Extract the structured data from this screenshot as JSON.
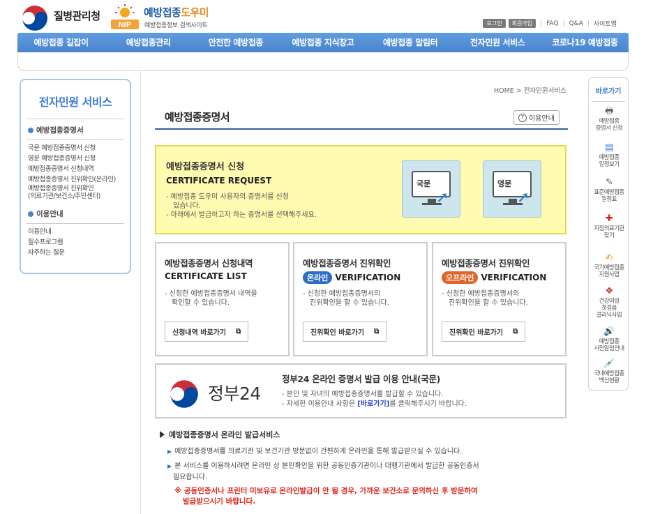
{
  "header": {
    "gov_name": "질병관리청",
    "nip_badge": "NIP",
    "brand_main": "예방접종",
    "brand_accent": "도우미",
    "brand_sub": "예방접종정보 검색사이트",
    "login": "로그인",
    "signup": "회원가입",
    "links": [
      "FAQ",
      "Q&A",
      "사이트맵"
    ]
  },
  "gnb": [
    "예방접종 길잡이",
    "예방접종관리",
    "안전한 예방접종",
    "예방접종 지식창고",
    "예방접종 알림터",
    "전자민원 서비스",
    "코로나19 예방접종"
  ],
  "lnb": {
    "title": "전자민원 서비스",
    "sections": [
      {
        "label": "예방접종증명서",
        "links": [
          "국문 예방접종증명서 신청",
          "영문 예방접종증명서 신청",
          "예방접종증명서 신청내역",
          "예방접종증명서 진위확인(온라인)",
          "예방접종증명서 진위확인",
          "(의료기관/보건소/주민센터)"
        ]
      },
      {
        "label": "이용안내",
        "links": [
          "이용안내",
          "필수프로그램",
          "자주하는 질문"
        ]
      }
    ]
  },
  "breadcrumb": {
    "home": "HOME",
    "sep": ">",
    "current": "전자민원서비스"
  },
  "page_title": "예방접종증명서",
  "help_button": "이용안내",
  "request": {
    "title": "예방접종증명서 신청",
    "subtitle": "CERTIFICATE REQUEST",
    "desc1": "- 예방접종 도우미 사용자의 증명서를 신청",
    "desc1b": "있습니다.",
    "desc2": "- 아래에서 발급하고자 하는 증명서를 선택해주세요.",
    "korean_label": "국문",
    "english_label": "영문"
  },
  "cards": [
    {
      "title": "예방접종증명서 신청내역",
      "subtitle": "CERTIFICATE LIST",
      "badge": "",
      "badge_color": "",
      "desc1": "- 신청한 예방접종증명서 내역을",
      "desc2": "확인할 수 있습니다.",
      "button": "신청내역 바로가기"
    },
    {
      "title": "예방접종증명서 진위확인",
      "subtitle": "VERIFICATION",
      "badge": "온라인",
      "badge_color": "#2d6cc7",
      "desc1": "- 신청한 예방접종증명서의",
      "desc2": "진위확인을 할 수 있습니다.",
      "button": "진위확인 바로가기"
    },
    {
      "title": "예방접종증명서 진위확인",
      "subtitle": "VERIFICATION",
      "badge": "오프라인",
      "badge_color": "#e2642a",
      "desc1": "- 신청한 예방접종증명서의",
      "desc2": "진위확인을 할 수 있습니다.",
      "button": "진위확인 바로가기"
    }
  ],
  "gov24": {
    "name": "정부24",
    "title": "정부24 온라인 증명서 발급 이용 안내(국문)",
    "line1": "- 본인 및 자녀의 예방접종증명서를 발급할 수 있습니다.",
    "line2_pre": "- 자세한 이용안내 사항은 ",
    "line2_link": "[바로가기]",
    "line2_post": "를 클릭해주시기 바랍니다."
  },
  "service": {
    "title": "예방접종증명서 온라인 발급서비스",
    "bullet1": "예방접종증명서를 의료기관 및 보건기관 방문없이 간편하게 온라인을 통해 발급받으실 수 있습니다.",
    "bullet2a": "본 서비스를 이용하시려면 온라인 상 본인확인을 위한 공동인증기관이나 대행기관에서 발급한 공동인증서",
    "bullet2b": "필요합니다.",
    "warning1": "※ 공동인증서나 프린터 미보유로 온라인발급이 안 될 경우, 가까운 보건소로 문의하신 후 방문하여",
    "warning2": "발급받으시기 바랍니다."
  },
  "quick": {
    "title": "바로가기",
    "items": [
      {
        "icon": "printer-icon",
        "lines": [
          "예방접종",
          "증명서 신청"
        ]
      },
      {
        "icon": "calendar-icon",
        "lines": [
          "예방접종",
          "일정보기"
        ]
      },
      {
        "icon": "pencil-icon",
        "lines": [
          "표준예방접종",
          "일정표"
        ]
      },
      {
        "icon": "hospital-icon",
        "lines": [
          "지정의료기관",
          "찾기"
        ]
      },
      {
        "icon": "document-icon",
        "lines": [
          "국가예방접종",
          "지원사업"
        ]
      },
      {
        "icon": "clinic-icon",
        "lines": [
          "건강여성",
          "첫걸음",
          "클리닉사업"
        ]
      },
      {
        "icon": "speaker-icon",
        "lines": [
          "예방접종",
          "사전알림안내"
        ]
      },
      {
        "icon": "vaccine-icon",
        "lines": [
          "국내예방접종",
          "백신현황"
        ]
      }
    ]
  }
}
